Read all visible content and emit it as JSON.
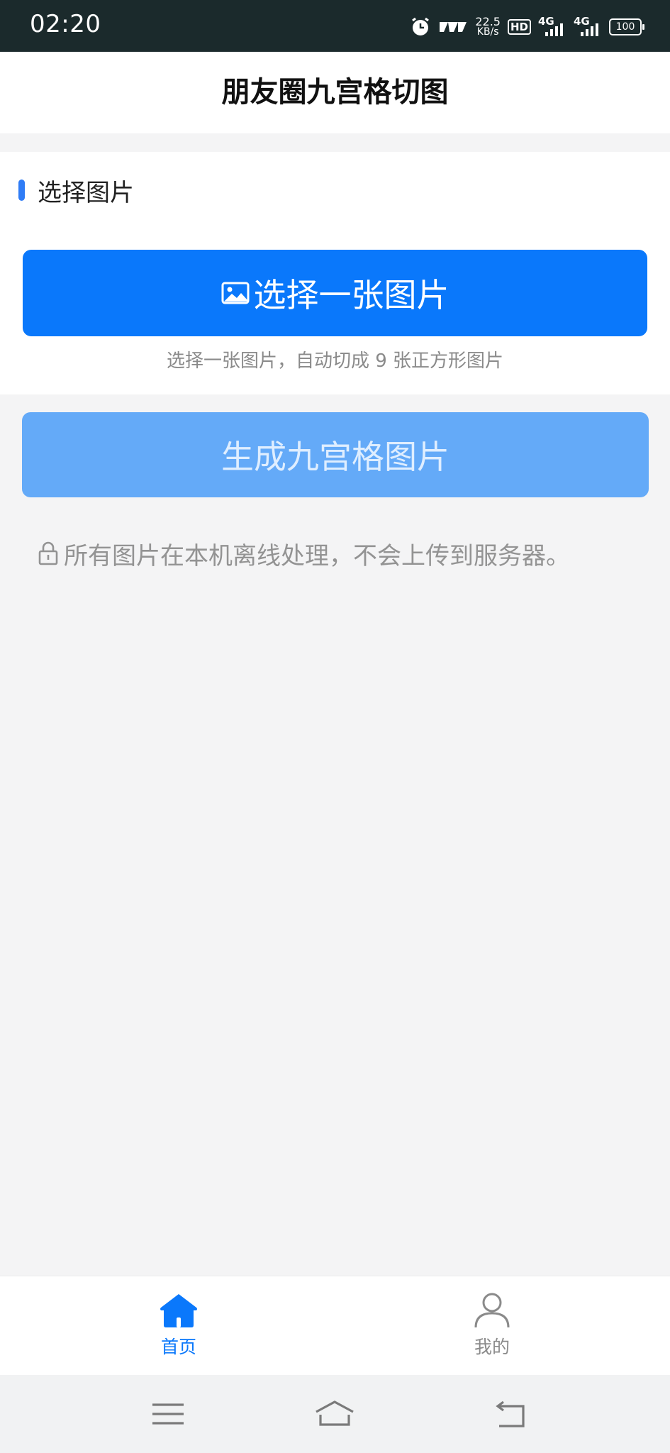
{
  "status_bar": {
    "time": "02:20",
    "net_speed_value": "22.5",
    "net_speed_unit": "KB/s",
    "hd_label": "HD",
    "network_1": "4G",
    "network_2": "4G",
    "battery": "100"
  },
  "header": {
    "title": "朋友圈九宫格切图"
  },
  "select_section": {
    "title": "选择图片",
    "button_label": "选择一张图片",
    "hint": "选择一张图片，自动切成 9 张正方形图片"
  },
  "generate": {
    "button_label": "生成九宫格图片"
  },
  "privacy": {
    "note": "所有图片在本机离线处理，不会上传到服务器。"
  },
  "tab_bar": {
    "tabs": [
      {
        "label": "首页",
        "icon": "home-icon",
        "active": true
      },
      {
        "label": "我的",
        "icon": "user-icon",
        "active": false
      }
    ]
  },
  "colors": {
    "primary": "#0a78fb",
    "primary_disabled": "#64aaf8",
    "status_bar_bg": "#1b2a2c",
    "page_bg": "#f4f4f5"
  }
}
